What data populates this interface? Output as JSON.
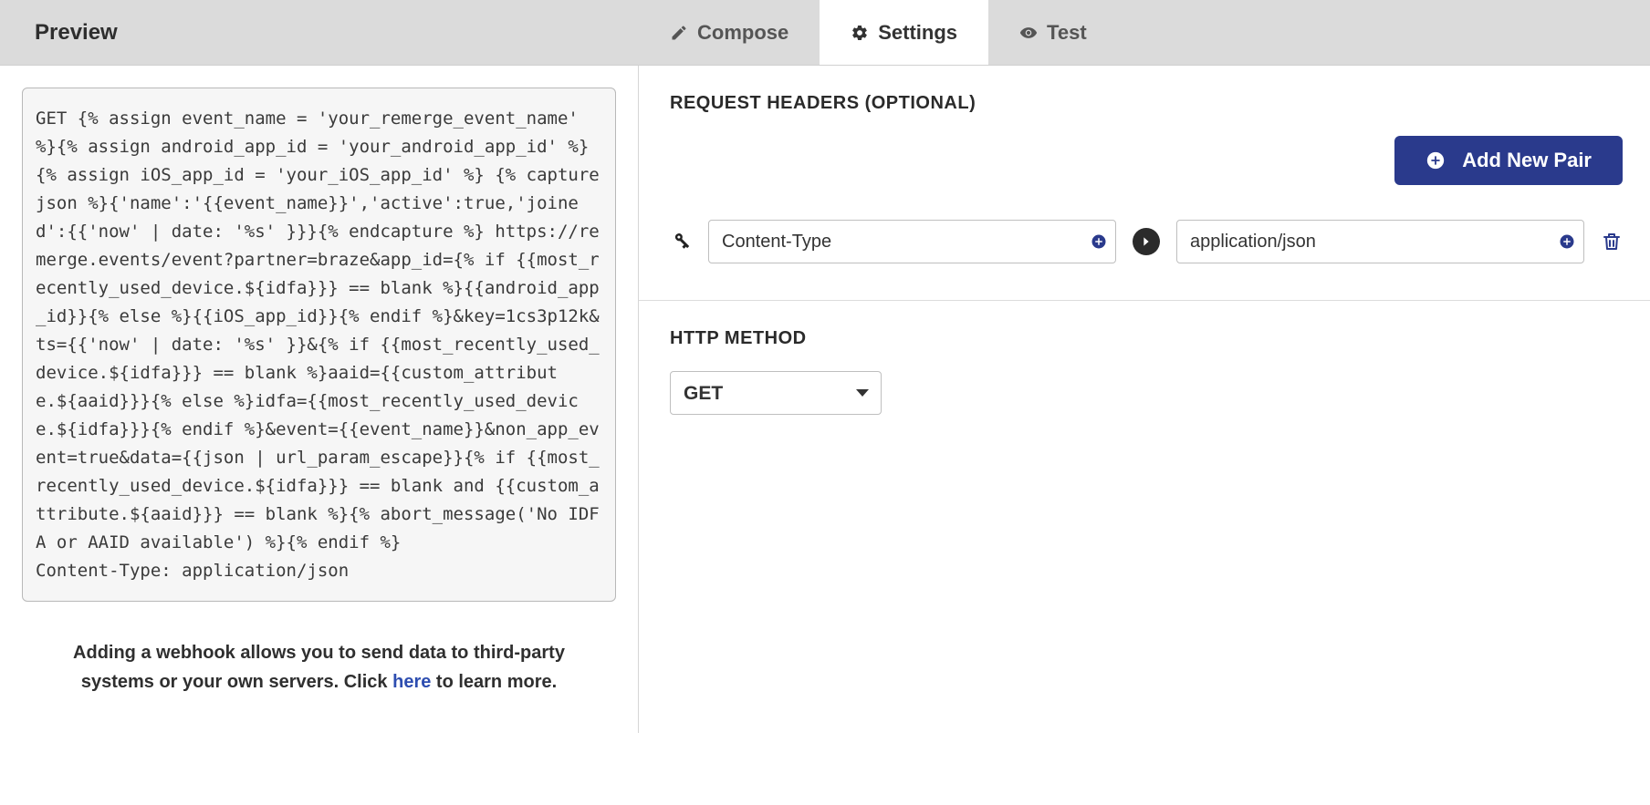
{
  "preview_label": "Preview",
  "tabs": {
    "compose": "Compose",
    "settings": "Settings",
    "test": "Test"
  },
  "preview_code": "GET {% assign event_name = 'your_remerge_event_name' %}{% assign android_app_id = 'your_android_app_id' %}{% assign iOS_app_id = 'your_iOS_app_id' %} {% capture json %}{'name':'{{event_name}}','active':true,'joined':{{'now' | date: '%s' }}}{% endcapture %} https://remerge.events/event?partner=braze&app_id={% if {{most_recently_used_device.${idfa}}} == blank %}{{android_app_id}}{% else %}{{iOS_app_id}}{% endif %}&key=1cs3p12k&ts={{'now' | date: '%s' }}&{% if {{most_recently_used_device.${idfa}}} == blank %}aaid={{custom_attribute.${aaid}}}{% else %}idfa={{most_recently_used_device.${idfa}}}{% endif %}&event={{event_name}}&non_app_event=true&data={{json | url_param_escape}}{% if {{most_recently_used_device.${idfa}}} == blank and {{custom_attribute.${aaid}}} == blank %}{% abort_message('No IDFA or AAID available') %}{% endif %}\nContent-Type: application/json",
  "help_text_prefix": "Adding a webhook allows you to send data to third-party systems or your own servers. Click ",
  "help_text_link": "here",
  "help_text_suffix": " to learn more.",
  "headers": {
    "section_label": "REQUEST HEADERS (OPTIONAL)",
    "add_pair_label": "Add New Pair",
    "rows": [
      {
        "key": "Content-Type",
        "value": "application/json"
      }
    ]
  },
  "http_method": {
    "section_label": "HTTP METHOD",
    "selected": "GET"
  }
}
